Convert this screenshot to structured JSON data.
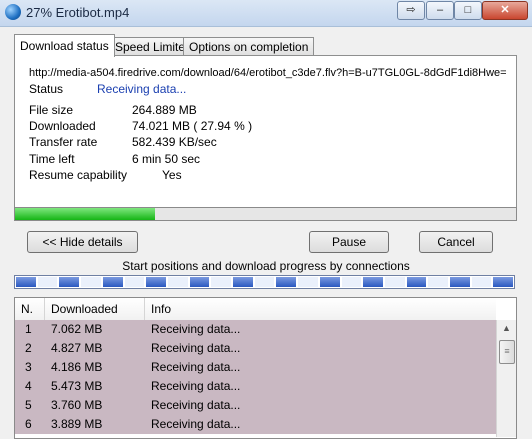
{
  "window": {
    "title": "27% Erotibot.mp4",
    "buttons": {
      "extra": "⇨",
      "minimize": "–",
      "maximize": "□",
      "close": "✕"
    }
  },
  "tabs": [
    {
      "label": "Download status",
      "active": true
    },
    {
      "label": "Speed Limiter",
      "active": false
    },
    {
      "label": "Options on completion",
      "active": false
    }
  ],
  "status": {
    "url": "http://media-a504.firedrive.com/download/64/erotibot_c3de7.flv?h=B-u7TGL0GL-8dGdF1di8Hwe=",
    "status_label": "Status",
    "status_value": "Receiving data...",
    "file_size_label": "File size",
    "file_size_value": "264.889  MB",
    "downloaded_label": "Downloaded",
    "downloaded_value": "74.021  MB  ( 27.94 % )",
    "transfer_label": "Transfer rate",
    "transfer_value": "582.439  KB/sec",
    "time_left_label": "Time left",
    "time_left_value": "6 min 50 sec",
    "resume_label": "Resume capability",
    "resume_value": "Yes"
  },
  "progress": {
    "percent": 27.94
  },
  "buttons": {
    "hide_details": "<< Hide details",
    "pause": "Pause",
    "cancel": "Cancel"
  },
  "connections": {
    "caption": "Start positions and download progress by connections",
    "segment_count": 23
  },
  "list": {
    "headers": [
      "N.",
      "Downloaded",
      "Info"
    ],
    "rows": [
      {
        "n": "1",
        "downloaded": "7.062  MB",
        "info": "Receiving data..."
      },
      {
        "n": "2",
        "downloaded": "4.827  MB",
        "info": "Receiving data..."
      },
      {
        "n": "3",
        "downloaded": "4.186  MB",
        "info": "Receiving data..."
      },
      {
        "n": "4",
        "downloaded": "5.473  MB",
        "info": "Receiving data..."
      },
      {
        "n": "5",
        "downloaded": "3.760  MB",
        "info": "Receiving data..."
      },
      {
        "n": "6",
        "downloaded": "3.889  MB",
        "info": "Receiving data..."
      }
    ]
  },
  "colors": {
    "progress_fill": "#16b516",
    "row_highlight": "#c9b8c2",
    "status_value": "#1a3fb0"
  }
}
